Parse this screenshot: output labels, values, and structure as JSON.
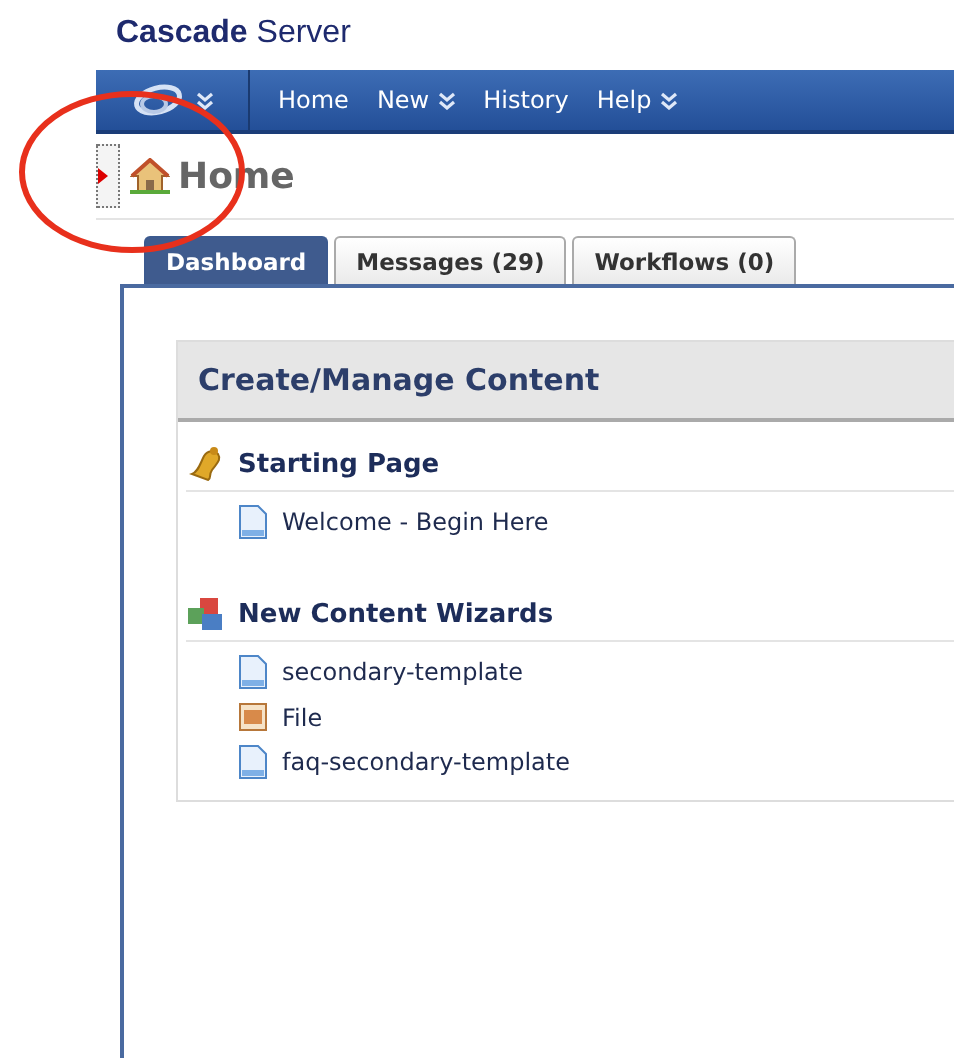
{
  "app_title": {
    "bold": "Cascade",
    "rest": "Server"
  },
  "nav": [
    {
      "label": "Home",
      "menu": false
    },
    {
      "label": "New",
      "menu": true
    },
    {
      "label": "History",
      "menu": false
    },
    {
      "label": "Help",
      "menu": true
    }
  ],
  "page_title": "Home",
  "tabs": [
    {
      "label": "Dashboard",
      "selected": true
    },
    {
      "label": "Messages (29)",
      "selected": false
    },
    {
      "label": "Workflows (0)",
      "selected": false
    }
  ],
  "panel": {
    "title": "Create/Manage Content",
    "sections": [
      {
        "kind": "starting",
        "title": "Starting Page",
        "items": [
          {
            "kind": "page",
            "label": "Welcome - Begin Here"
          }
        ]
      },
      {
        "kind": "wizards",
        "title": "New Content Wizards",
        "items": [
          {
            "kind": "page",
            "label": "secondary-template"
          },
          {
            "kind": "file",
            "label": "File"
          },
          {
            "kind": "page",
            "label": "faq-secondary-template"
          }
        ]
      }
    ]
  }
}
